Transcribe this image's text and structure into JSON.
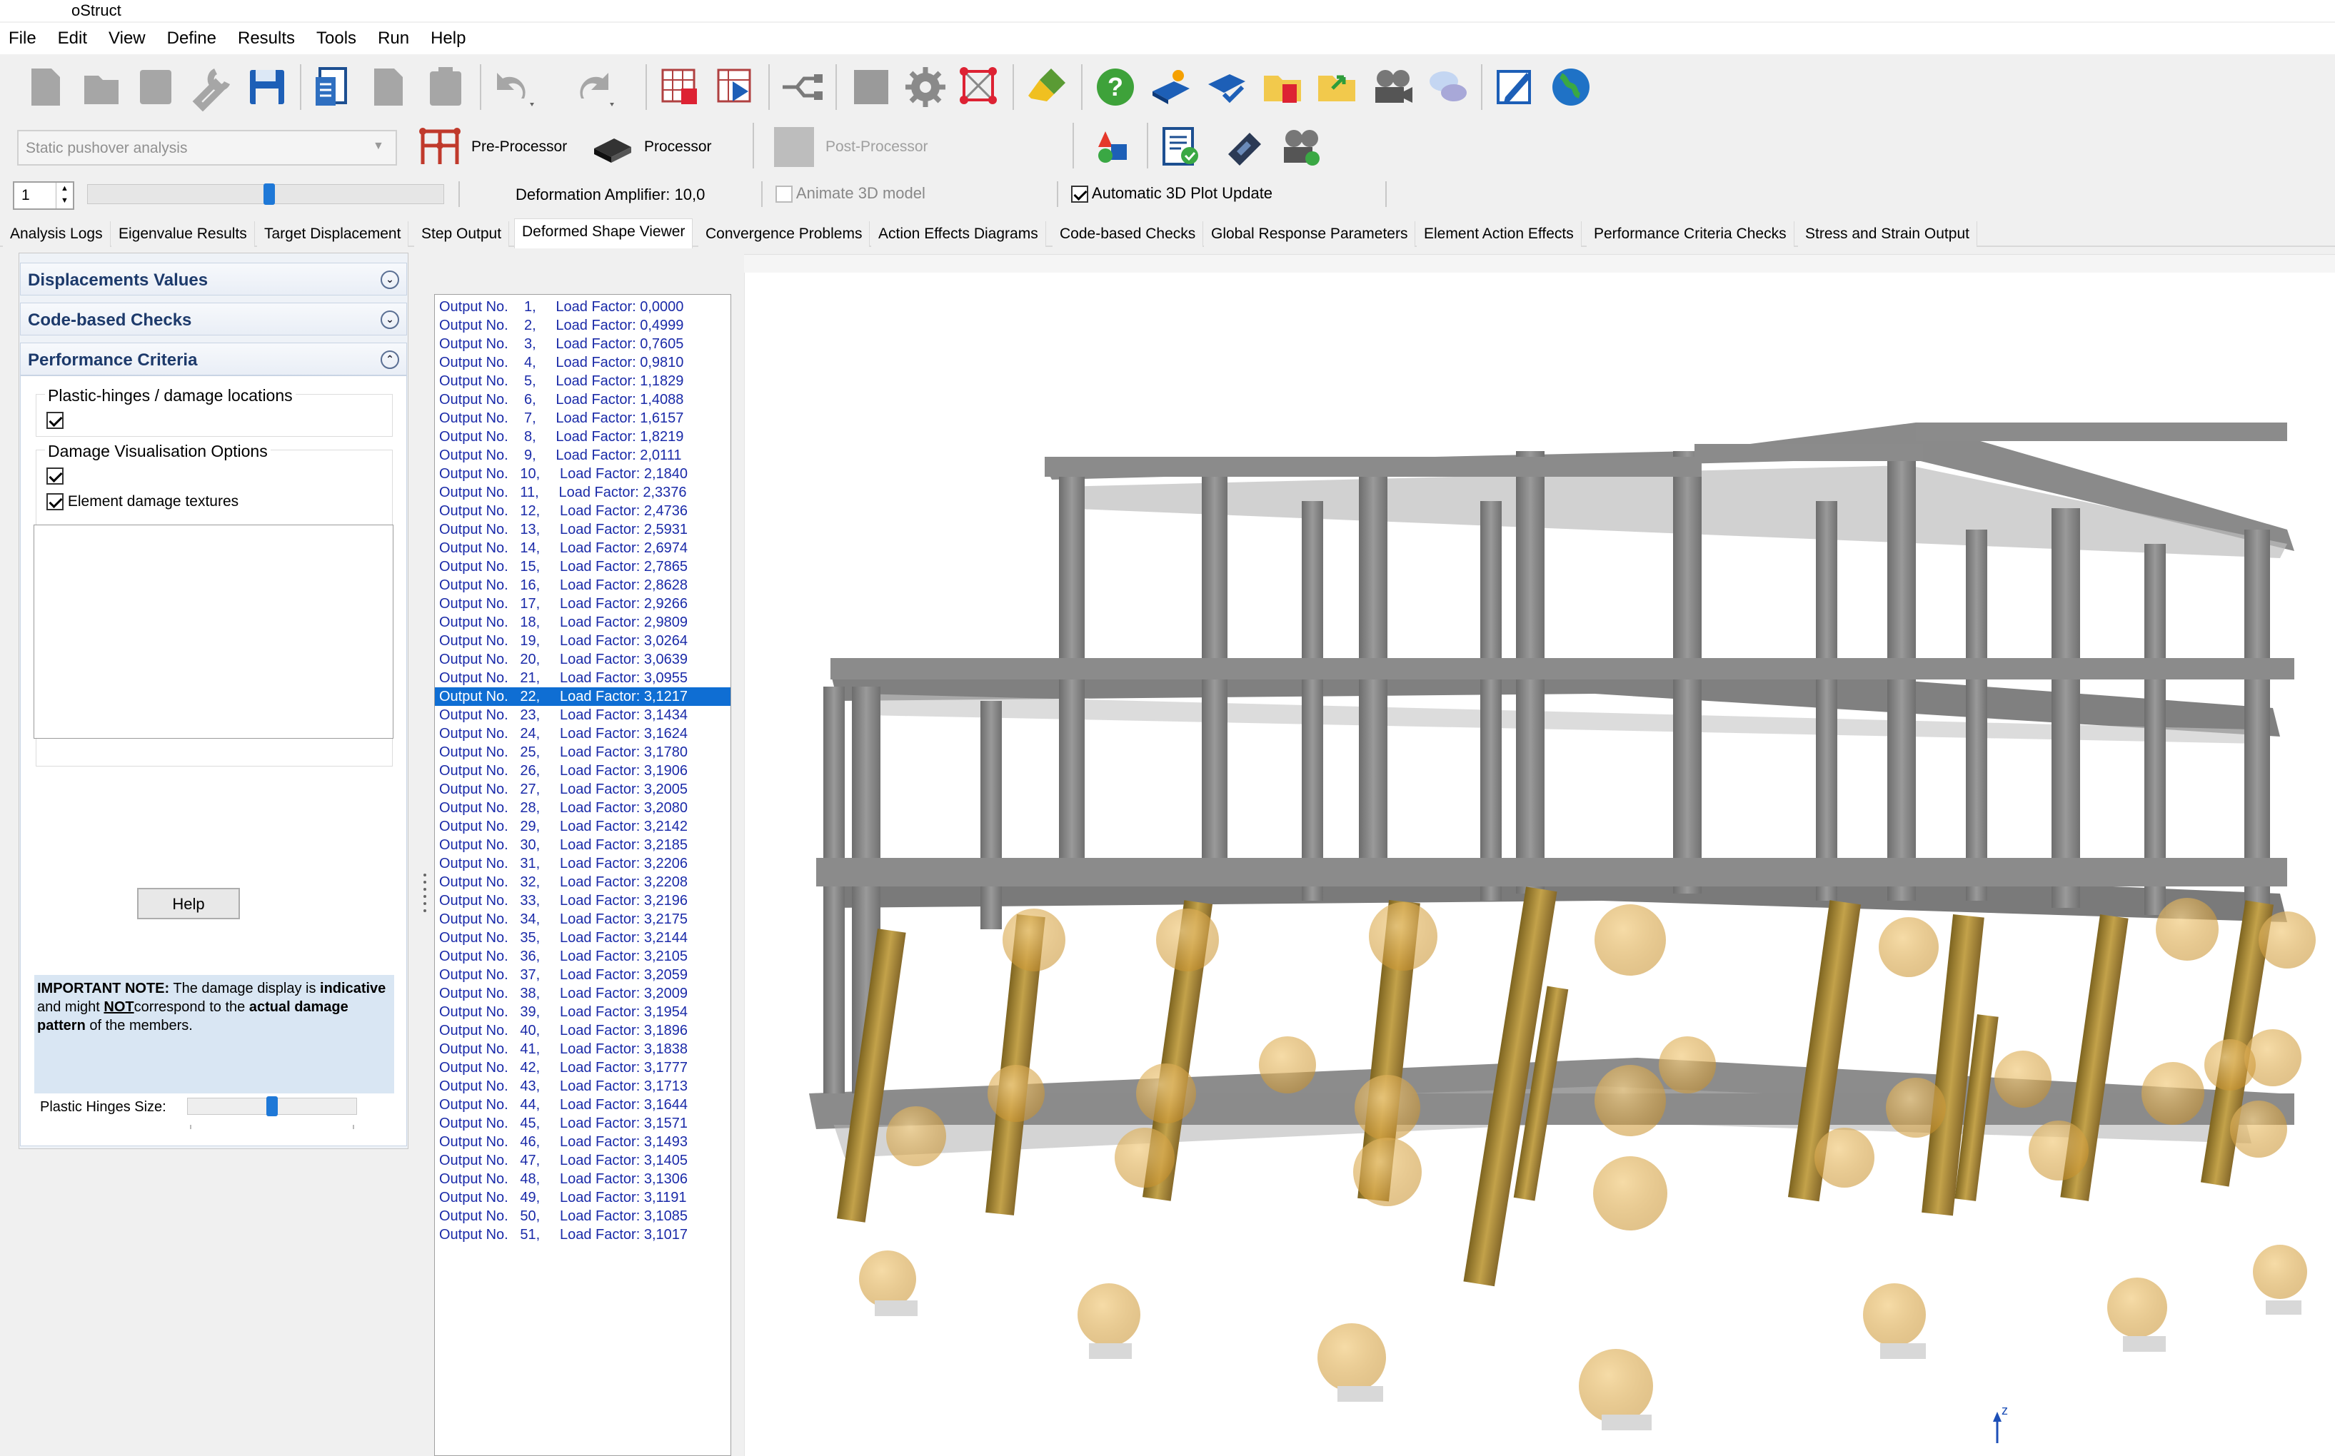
{
  "window": {
    "title": "oStruct"
  },
  "menu": [
    "File",
    "Edit",
    "View",
    "Define",
    "Results",
    "Tools",
    "Run",
    "Help"
  ],
  "toolbar": {
    "icons": [
      "new-icon",
      "open-icon",
      "save-as-icon",
      "tools-icon",
      "save-icon",
      "report-icon",
      "copy-icon",
      "paste-icon",
      "undo-icon",
      "redo-icon",
      "model-grid-icon",
      "play-model-icon",
      "connect-icon",
      "stop-icon",
      "settings-gear-icon",
      "analysis-model-icon",
      "brush-icon",
      "help-icon",
      "manual-icon",
      "book-check-icon",
      "open-folder-icon",
      "export-folder-icon",
      "video-icon",
      "chat-icon",
      "edit-note-icon",
      "web-globe-icon"
    ]
  },
  "analysis": {
    "type_select": "Static pushover analysis",
    "pre_processor": "Pre-Processor",
    "processor": "Processor",
    "post_processor": "Post-Processor"
  },
  "controls": {
    "step_value": "1",
    "deformation_amplifier": "Deformation Amplifier: 10,0",
    "animate_3d": "Animate 3D model",
    "animate_checked": false,
    "auto_update": "Automatic 3D Plot Update",
    "auto_update_checked": true
  },
  "tabs": [
    "Analysis Logs",
    "Eigenvalue Results",
    "Target Displacement",
    "Step Output",
    "Deformed Shape Viewer",
    "Convergence Problems",
    "Action Effects Diagrams",
    "Code-based Checks",
    "Global Response Parameters",
    "Element Action Effects",
    "Performance Criteria Checks",
    "Stress and Strain Output"
  ],
  "active_tab": "Deformed Shape Viewer",
  "left_panel": {
    "sections": {
      "displacements": "Displacements Values",
      "code_checks": "Code-based Checks",
      "performance": "Performance Criteria"
    },
    "plastic_hinges_group": "Plastic-hinges / damage locations",
    "damage_vis_group": "Damage Visualisation Options",
    "element_damage_textures": "Element damage textures",
    "note": {
      "p1": "IMPORTANT NOTE:",
      "p2": " The damage display is ",
      "p3": "indicative",
      "p4": " and might ",
      "p5": "NOT",
      "p6": "correspond to the ",
      "p7": "actual damage pattern",
      "p8": " of the members."
    },
    "plastic_hinges_size": "Plastic Hinges Size:",
    "help": "Help"
  },
  "outputs": [
    "Output No.    1,     Load Factor: 0,0000",
    "Output No.    2,     Load Factor: 0,4999",
    "Output No.    3,     Load Factor: 0,7605",
    "Output No.    4,     Load Factor: 0,9810",
    "Output No.    5,     Load Factor: 1,1829",
    "Output No.    6,     Load Factor: 1,4088",
    "Output No.    7,     Load Factor: 1,6157",
    "Output No.    8,     Load Factor: 1,8219",
    "Output No.    9,     Load Factor: 2,0111",
    "Output No.   10,     Load Factor: 2,1840",
    "Output No.   11,     Load Factor: 2,3376",
    "Output No.   12,     Load Factor: 2,4736",
    "Output No.   13,     Load Factor: 2,5931",
    "Output No.   14,     Load Factor: 2,6974",
    "Output No.   15,     Load Factor: 2,7865",
    "Output No.   16,     Load Factor: 2,8628",
    "Output No.   17,     Load Factor: 2,9266",
    "Output No.   18,     Load Factor: 2,9809",
    "Output No.   19,     Load Factor: 3,0264",
    "Output No.   20,     Load Factor: 3,0639",
    "Output No.   21,     Load Factor: 3,0955",
    "Output No.   22,     Load Factor: 3,1217",
    "Output No.   23,     Load Factor: 3,1434",
    "Output No.   24,     Load Factor: 3,1624",
    "Output No.   25,     Load Factor: 3,1780",
    "Output No.   26,     Load Factor: 3,1906",
    "Output No.   27,     Load Factor: 3,2005",
    "Output No.   28,     Load Factor: 3,2080",
    "Output No.   29,     Load Factor: 3,2142",
    "Output No.   30,     Load Factor: 3,2185",
    "Output No.   31,     Load Factor: 3,2206",
    "Output No.   32,     Load Factor: 3,2208",
    "Output No.   33,     Load Factor: 3,2196",
    "Output No.   34,     Load Factor: 3,2175",
    "Output No.   35,     Load Factor: 3,2144",
    "Output No.   36,     Load Factor: 3,2105",
    "Output No.   37,     Load Factor: 3,2059",
    "Output No.   38,     Load Factor: 3,2009",
    "Output No.   39,     Load Factor: 3,1954",
    "Output No.   40,     Load Factor: 3,1896",
    "Output No.   41,     Load Factor: 3,1838",
    "Output No.   42,     Load Factor: 3,1777",
    "Output No.   43,     Load Factor: 3,1713",
    "Output No.   44,     Load Factor: 3,1644",
    "Output No.   45,     Load Factor: 3,1571",
    "Output No.   46,     Load Factor: 3,1493",
    "Output No.   47,     Load Factor: 3,1405",
    "Output No.   48,     Load Factor: 3,1306",
    "Output No.   49,     Load Factor: 3,1191",
    "Output No.   50,     Load Factor: 3,1085",
    "Output No.   51,     Load Factor: 3,1017"
  ],
  "selected_output": 22,
  "viewport": {
    "axis_label": "z"
  }
}
